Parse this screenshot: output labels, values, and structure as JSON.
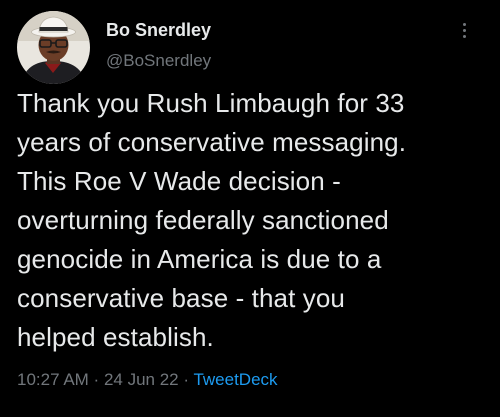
{
  "author": {
    "name": "Bo Snerdley",
    "handle": "@BoSnerdley"
  },
  "tweet": {
    "text": "Thank you Rush Limbaugh for 33\nyears of conservative messaging.\nThis Roe V Wade decision -\noverturning federally sanctioned\ngenocide in America is due to a\nconservative base - that you\nhelped establish.",
    "time": "10:27 AM",
    "separator_1": " · ",
    "date": "24 Jun 22",
    "separator_2": " · ",
    "source": "TweetDeck"
  },
  "icons": {
    "more": "more-vertical-icon",
    "avatar": "avatar"
  },
  "colors": {
    "background": "#000000",
    "primary_text": "#e7e9ea",
    "secondary_text": "#71767b",
    "link": "#1d9bf0"
  }
}
